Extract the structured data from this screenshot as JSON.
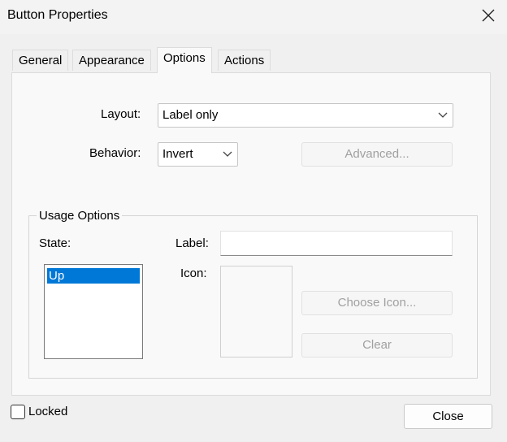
{
  "window": {
    "title": "Button Properties",
    "close_icon": "close-icon"
  },
  "tabs": [
    {
      "label": "General",
      "active": false
    },
    {
      "label": "Appearance",
      "active": false
    },
    {
      "label": "Options",
      "active": true
    },
    {
      "label": "Actions",
      "active": false
    }
  ],
  "options": {
    "layout_label": "Layout:",
    "layout_value": "Label only",
    "behavior_label": "Behavior:",
    "behavior_value": "Invert",
    "advanced_button": "Advanced..."
  },
  "usage": {
    "title": "Usage Options",
    "state_label": "State:",
    "states": [
      "Up"
    ],
    "selected_state": "Up",
    "label_label": "Label:",
    "label_value": "",
    "icon_label": "Icon:",
    "choose_icon_button": "Choose Icon...",
    "clear_button": "Clear"
  },
  "footer": {
    "locked_label": "Locked",
    "locked_checked": false,
    "close_button": "Close"
  },
  "colors": {
    "selection": "#0078d7",
    "disabled_text": "#a0a0a0",
    "panel": "#f9f9f9",
    "client": "#f0f0f0"
  }
}
